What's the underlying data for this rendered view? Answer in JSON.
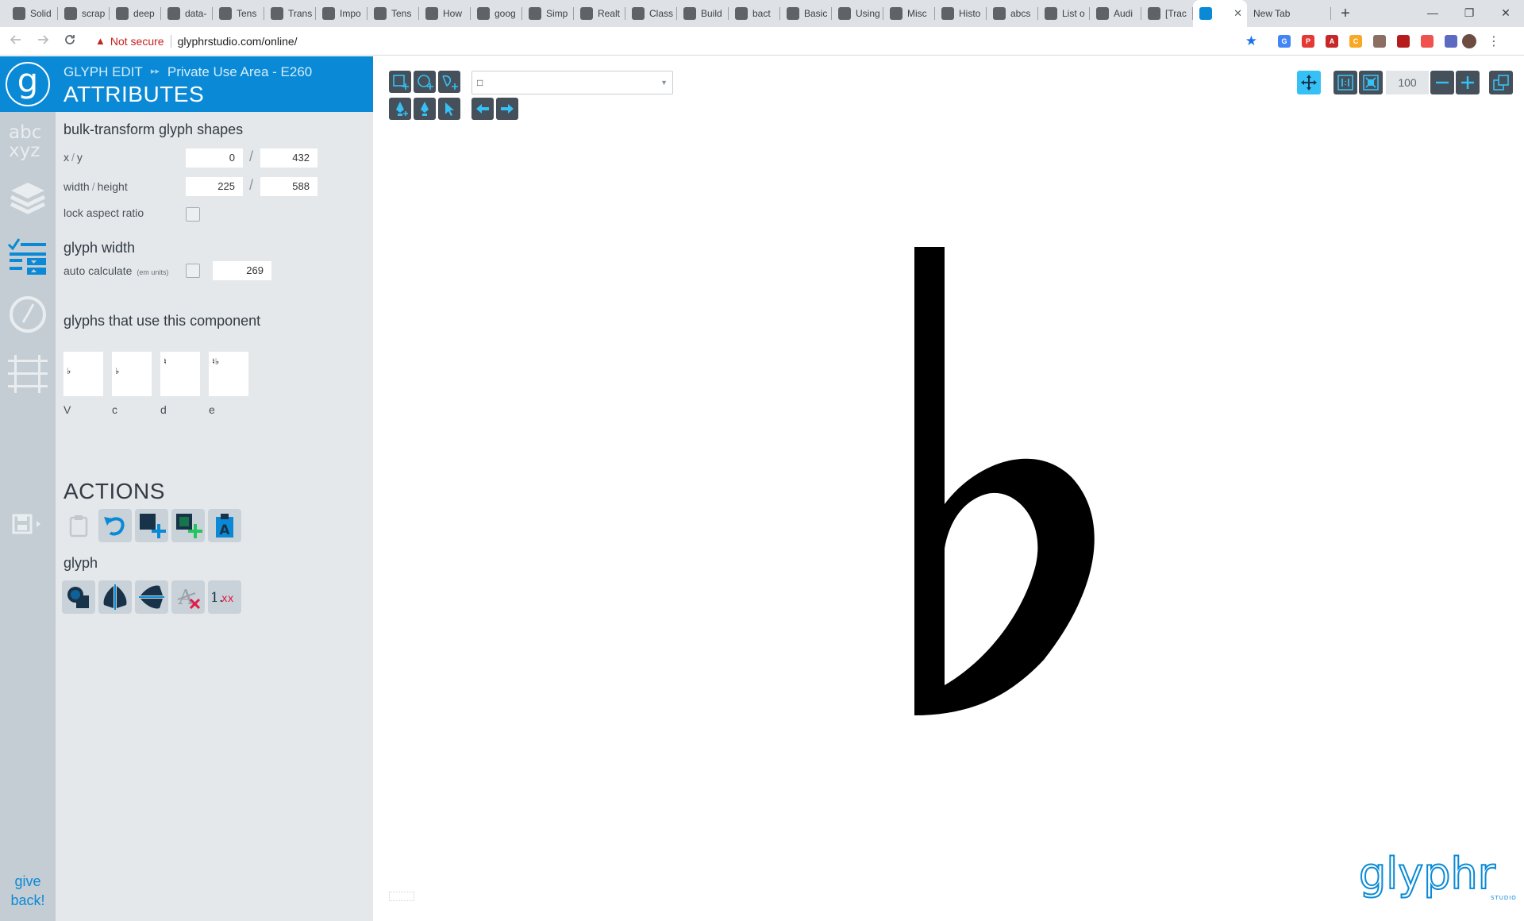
{
  "browser": {
    "tabs": [
      {
        "label": "Solid"
      },
      {
        "label": "scrap"
      },
      {
        "label": "deep"
      },
      {
        "label": "data-"
      },
      {
        "label": "Tens"
      },
      {
        "label": "Trans"
      },
      {
        "label": "Impo"
      },
      {
        "label": "Tens"
      },
      {
        "label": "How"
      },
      {
        "label": "goog"
      },
      {
        "label": "Simp"
      },
      {
        "label": "Realt"
      },
      {
        "label": "Class"
      },
      {
        "label": "Build"
      },
      {
        "label": "bact"
      },
      {
        "label": "Basic"
      },
      {
        "label": "Using"
      },
      {
        "label": "Misc"
      },
      {
        "label": "Histo"
      },
      {
        "label": "abcs"
      },
      {
        "label": "List o"
      },
      {
        "label": "Audi"
      },
      {
        "label": "[Trac"
      }
    ],
    "active_tab_close": "✕",
    "new_tab_label": "New Tab",
    "new_tab_plus": "+",
    "window_controls": {
      "minimize": "—",
      "restore": "❐",
      "close": "✕"
    },
    "security_label": "Not secure",
    "url": "glyphrstudio.com/online/"
  },
  "colors": {
    "accent": "#0a8ad6",
    "nav_bg": "#c4cdd3",
    "panel_bg": "#e4e8eb",
    "tool_dark": "#45505a",
    "tool_selected": "#35c1f5",
    "glyph_fill": "#000000"
  },
  "navigation": {
    "items": [
      {
        "name": "glyph-chooser",
        "icon": "abc-xyz-icon"
      },
      {
        "name": "layers",
        "icon": "layers-icon"
      },
      {
        "name": "attributes",
        "icon": "attributes-checklist-icon",
        "active": true
      },
      {
        "name": "history",
        "icon": "history-clock-icon"
      },
      {
        "name": "guides",
        "icon": "guides-grid-icon"
      },
      {
        "name": "save",
        "icon": "save-disk-icon"
      }
    ],
    "give_back_line1": "give",
    "give_back_line2": "back!"
  },
  "panel": {
    "breadcrumb_mode": "GLYPH EDIT",
    "breadcrumb_arrows": "▸▸",
    "breadcrumb_location": "Private Use Area - E260",
    "title": "ATTRIBUTES",
    "bulk_transform": {
      "title": "bulk-transform glyph shapes",
      "xy_label_x": "x",
      "xy_label_y": "y",
      "x": "0",
      "y": "432",
      "wh_label_w": "width",
      "wh_label_h": "height",
      "width": "225",
      "height": "588",
      "lock_aspect_label": "lock aspect ratio",
      "lock_aspect_checked": false
    },
    "glyph_width": {
      "title": "glyph width",
      "auto_label": "auto calculate",
      "em_units": "(em units)",
      "auto_checked": false,
      "value": "269"
    },
    "used_in": {
      "title": "glyphs that use this component",
      "glyphs": [
        {
          "label": "V",
          "mark": "♭"
        },
        {
          "label": "c",
          "mark": "♭"
        },
        {
          "label": "d",
          "mark": "♮"
        },
        {
          "label": "e",
          "mark": "♮♭"
        }
      ]
    },
    "actions_title": "ACTIONS",
    "actions": [
      {
        "name": "paste",
        "icon": "clipboard-icon",
        "enabled": false
      },
      {
        "name": "undo",
        "icon": "undo-icon",
        "enabled": true
      },
      {
        "name": "add-shape",
        "icon": "add-shape-icon",
        "enabled": true
      },
      {
        "name": "add-component",
        "icon": "add-component-icon",
        "enabled": true
      },
      {
        "name": "get-shapes",
        "icon": "paste-glyph-icon",
        "enabled": true
      }
    ],
    "glyph_section_title": "glyph",
    "glyph_actions": [
      {
        "name": "combine-shapes",
        "icon": "combine-shapes-icon"
      },
      {
        "name": "flip-horizontal",
        "icon": "flip-horizontal-icon"
      },
      {
        "name": "flip-vertical",
        "icon": "flip-vertical-icon"
      },
      {
        "name": "clear-glyph",
        "icon": "clear-glyph-icon"
      },
      {
        "name": "round-values",
        "icon": "round-values-icon",
        "text": "1.xx"
      }
    ]
  },
  "canvas": {
    "tools_row1": [
      "new-rectangle-tool",
      "new-oval-tool",
      "new-path-tool"
    ],
    "tools_row2": [
      "pen-tool",
      "pen-plus-tool",
      "arrow-tool"
    ],
    "nav_arrows": [
      "previous-glyph",
      "next-glyph"
    ],
    "glyph_select_value": "□",
    "zoom_value": "100",
    "view_tools": [
      "pan-tool",
      "actual-size",
      "fit-to-screen",
      "zoom-out",
      "zoom-in",
      "popout"
    ],
    "selected_view_tool": "pan-tool",
    "brand": "glyphr",
    "brand_sub": "STUDIO"
  }
}
